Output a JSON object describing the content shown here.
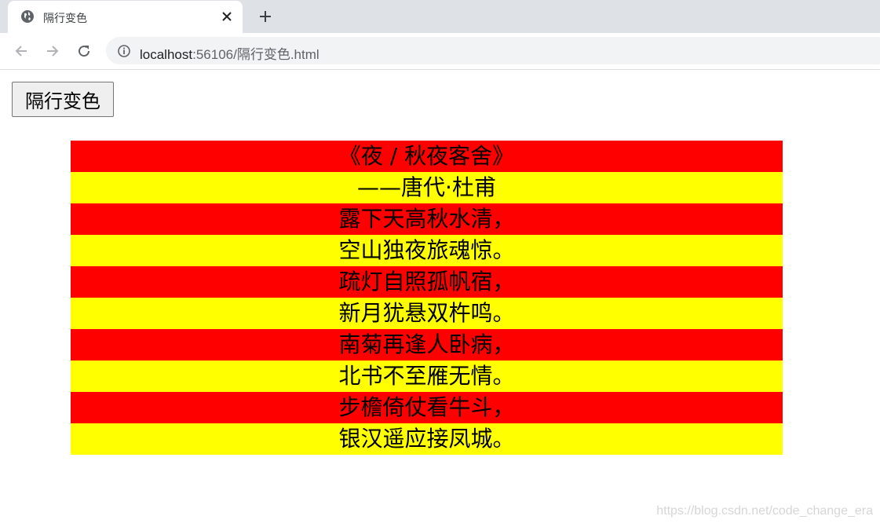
{
  "browser": {
    "tab": {
      "title": "隔行变色",
      "favicon": "globe-icon",
      "close_icon": "close-icon"
    },
    "new_tab_icon": "plus-icon",
    "nav": {
      "back_icon": "arrow-left-icon",
      "forward_icon": "arrow-right-icon",
      "reload_icon": "reload-icon"
    },
    "address_bar": {
      "info_icon": "info-icon",
      "host": "localhost",
      "path": ":56106/隔行变色.html"
    }
  },
  "page": {
    "button_label": "隔行变色",
    "row_colors": {
      "odd": "#ff0000",
      "even": "#ffff00"
    },
    "poem_lines": [
      "《夜 / 秋夜客舍》",
      "——唐代·杜甫",
      "露下天高秋水清，",
      "空山独夜旅魂惊。",
      "疏灯自照孤帆宿，",
      "新月犹悬双杵鸣。",
      "南菊再逢人卧病，",
      "北书不至雁无情。",
      "步檐倚仗看牛斗，",
      "银汉遥应接凤城。"
    ]
  },
  "watermark": "https://blog.csdn.net/code_change_era"
}
